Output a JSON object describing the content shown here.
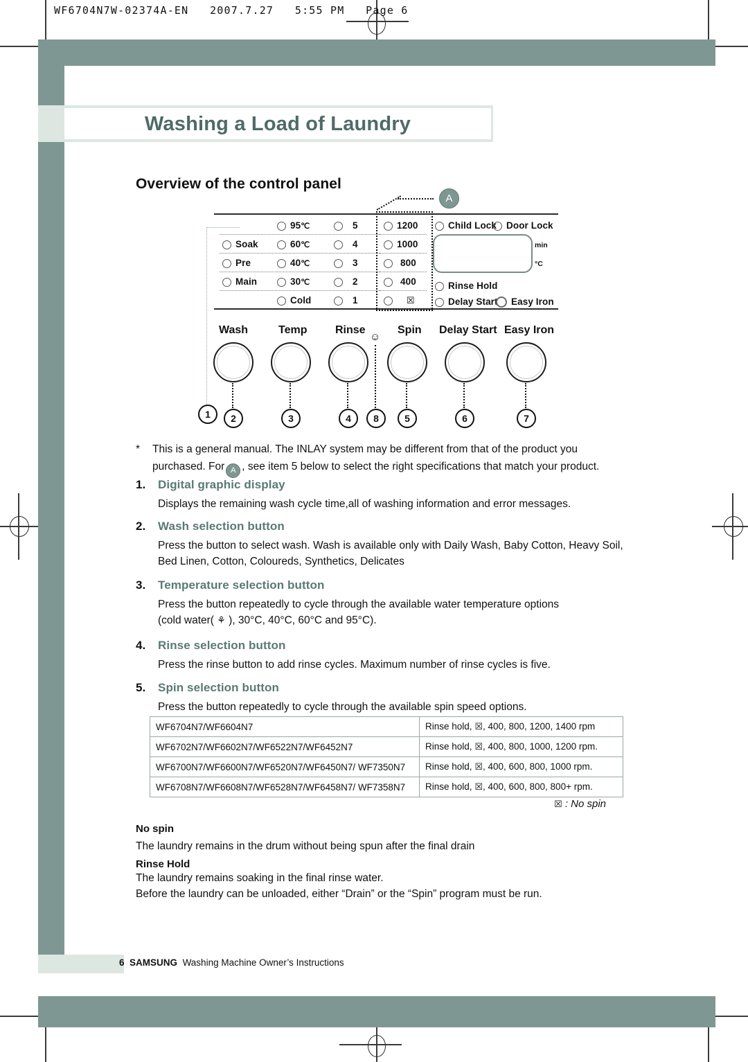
{
  "print_header": "WF6704N7W-02374A-EN   2007.7.27   5:55 PM   Page 6",
  "page_title": "Washing a Load of Laundry",
  "section_heading": "Overview of the control panel",
  "badge_a": "A",
  "panel": {
    "columns": {
      "wash": [
        "Soak",
        "Pre",
        "Main"
      ],
      "temp": [
        "95",
        "60",
        "40",
        "30",
        "Cold"
      ],
      "temp_unit": "℃",
      "rinse": [
        "5",
        "4",
        "3",
        "2",
        "1"
      ],
      "spin": [
        "1200",
        "1000",
        "800",
        "400",
        "no-spin-icon"
      ]
    },
    "indicators": {
      "child_lock": "Child Lock",
      "door_lock": "Door Lock",
      "rinse_hold": "Rinse Hold",
      "delay_start": "Delay Start",
      "easy_iron": "Easy Iron"
    },
    "display_units": {
      "min": "min",
      "celsius": "°C"
    },
    "knob_labels": [
      "Wash",
      "Temp",
      "Rinse",
      "Spin",
      "Delay Start",
      "Easy Iron"
    ],
    "callouts": [
      "1",
      "2",
      "3",
      "4",
      "8",
      "5",
      "6",
      "7"
    ]
  },
  "note": {
    "marker": "*",
    "line1": "This is a general manual. The INLAY system may be different from that of the product you",
    "line2_before": "purchased. For",
    "line2_after": ", see item 5 below to select the right specifications that match your product."
  },
  "sections": [
    {
      "num": "1.",
      "head": "Digital graphic display",
      "body": "Displays the remaining wash cycle time,all of washing information and error messages."
    },
    {
      "num": "2.",
      "head": "Wash selection button",
      "body": "Press the button to select wash. Wash is available only with Daily Wash, Baby Cotton, Heavy Soil, Bed Linen, Cotton, Coloureds, Synthetics, Delicates"
    },
    {
      "num": "3.",
      "head": "Temperature selection button",
      "body_line1": "Press the button repeatedly to cycle through the available water temperature options",
      "body_line2_before": "(cold water(",
      "body_line2_after": "),  30°C, 40°C, 60°C and 95°C)."
    },
    {
      "num": "4.",
      "head": "Rinse selection button",
      "body": "Press the rinse button to add rinse cycles. Maximum number of rinse cycles is five."
    },
    {
      "num": "5.",
      "head": "Spin selection button",
      "body": "Press the button repeatedly to cycle through the available spin speed options."
    }
  ],
  "spin_table": {
    "rows": [
      {
        "models": "WF6704N7/WF6604N7",
        "before": "Rinse hold,",
        "after": ", 400, 800, 1200, 1400 rpm"
      },
      {
        "models": "WF6702N7/WF6602N7/WF6522N7/WF6452N7",
        "before": "Rinse hold,",
        "after": ", 400, 800, 1000, 1200 rpm."
      },
      {
        "models": "WF6700N7/WF6600N7/WF6520N7/WF6450N7/ WF7350N7",
        "before": "Rinse hold,",
        "after": ", 400, 600, 800, 1000 rpm."
      },
      {
        "models": "WF6708N7/WF6608N7/WF6528N7/WF6458N7/ WF7358N7",
        "before": "Rinse hold,",
        "after": ", 400, 600, 800, 800+ rpm."
      }
    ]
  },
  "legend": ": No spin",
  "definitions": [
    {
      "term": "No spin",
      "text": "The laundry remains in the drum without being spun after the final drain"
    },
    {
      "term": "Rinse Hold",
      "text_line1": "The laundry remains soaking in the final rinse water.",
      "text_line2": "Before the laundry can be unloaded, either “Drain” or the “Spin” program must be run."
    }
  ],
  "footer": {
    "page_number": "6",
    "brand": "SAMSUNG",
    "text": "Washing Machine Owner’s Instructions"
  },
  "colors": {
    "frame_green": "#7f9792",
    "pale_green": "#dde7e2",
    "heading_green": "#5a7a74",
    "title_green": "#4f6b67"
  }
}
